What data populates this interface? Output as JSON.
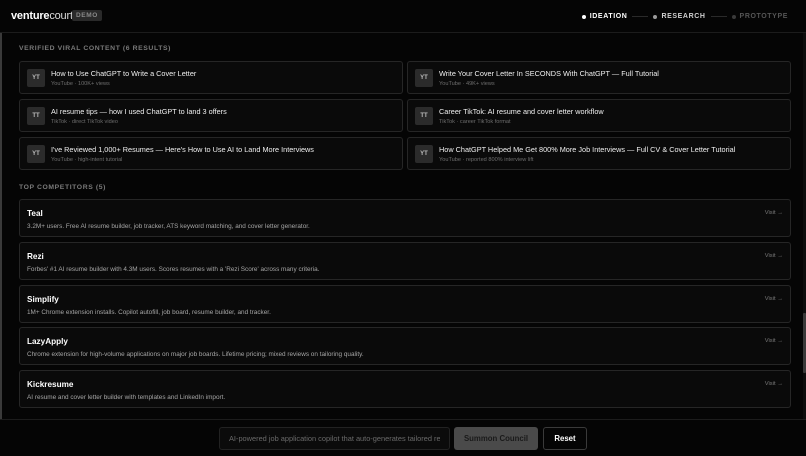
{
  "header": {
    "logo_bold": "venture",
    "logo_light": "court",
    "badge": "DEMO",
    "steps": [
      {
        "label": "IDEATION",
        "state": "done"
      },
      {
        "label": "RESEARCH",
        "state": "active"
      },
      {
        "label": "PROTOTYPE",
        "state": "pending"
      }
    ]
  },
  "viral": {
    "title": "VERIFIED VIRAL CONTENT (6 RESULTS)",
    "items": [
      {
        "badge": "YT",
        "title": "How to Use ChatGPT to Write a Cover Letter",
        "meta": "YouTube · 100K+ views"
      },
      {
        "badge": "YT",
        "title": "Write Your Cover Letter In SECONDS With ChatGPT — Full Tutorial",
        "meta": "YouTube · 49K+ views"
      },
      {
        "badge": "TT",
        "title": "AI resume tips — how I used ChatGPT to land 3 offers",
        "meta": "TikTok · direct TikTok video"
      },
      {
        "badge": "TT",
        "title": "Career TikTok: AI resume and cover letter workflow",
        "meta": "TikTok · career TikTok format"
      },
      {
        "badge": "YT",
        "title": "I've Reviewed 1,000+ Resumes — Here's How to Use AI to Land More Interviews",
        "meta": "YouTube · high-intent tutorial"
      },
      {
        "badge": "YT",
        "title": "How ChatGPT Helped Me Get 800% More Job Interviews — Full CV & Cover Letter Tutorial",
        "meta": "YouTube · reported 800% interview lift"
      }
    ]
  },
  "competitors": {
    "title": "TOP COMPETITORS (5)",
    "visit_label": "Visit →",
    "items": [
      {
        "name": "Teal",
        "desc": "3.2M+ users. Free AI resume builder, job tracker, ATS keyword matching, and cover letter generator."
      },
      {
        "name": "Rezi",
        "desc": "Forbes' #1 AI resume builder with 4.3M users. Scores resumes with a 'Rezi Score' across many criteria."
      },
      {
        "name": "Simplify",
        "desc": "1M+ Chrome extension installs. Copilot autofill, job board, resume builder, and tracker."
      },
      {
        "name": "LazyApply",
        "desc": "Chrome extension for high-volume applications on major job boards. Lifetime pricing; mixed reviews on tailoring quality."
      },
      {
        "name": "Kickresume",
        "desc": "AI resume and cover letter builder with templates and LinkedIn import."
      }
    ]
  },
  "bottom": {
    "input_value": "AI-powered job application copilot that auto-generates tailored resumes and cover letters",
    "summon_label": "Summon Council",
    "reset_label": "Reset"
  }
}
